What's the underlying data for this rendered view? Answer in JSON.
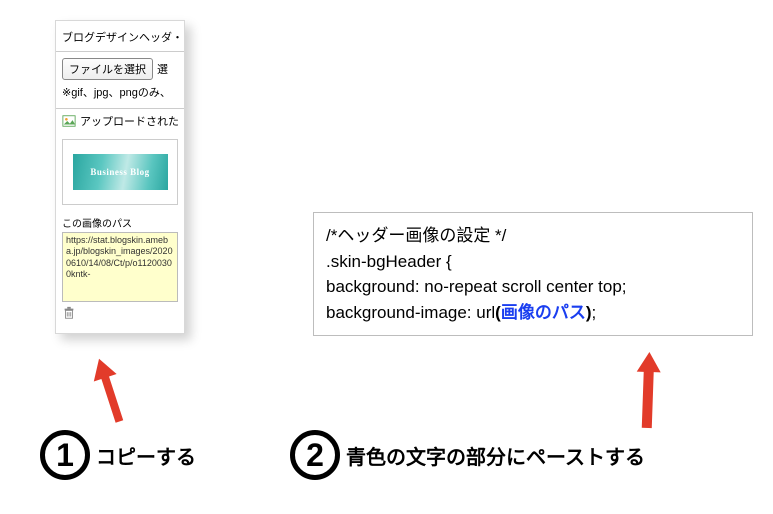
{
  "panel": {
    "title": "ブログデザインヘッダ・",
    "file_button": "ファイルを選択",
    "file_aux": "選",
    "note": "※gif、jpg、pngのみ、",
    "uploaded_label": "アップロードされた",
    "thumb_text": "Business Blog",
    "path_label": "この画像のパス",
    "path_value": "https://stat.blogskin.ameba.jp/blogskin_images/20200610/14/08/Ct/p/o11200300kntk-"
  },
  "code": {
    "line1": "/*ヘッダー画像の設定 */",
    "line2": ".skin-bgHeader {",
    "line3": "background: no-repeat scroll center top;",
    "line4a": "background-image: url",
    "line4_open": "(",
    "line4_path": "画像のパス",
    "line4_close": ")",
    "line4_semi": ";"
  },
  "steps": {
    "s1_num": "1",
    "s1_text": "コピーする",
    "s2_num": "2",
    "s2_text": "青色の文字の部分にペーストする"
  }
}
